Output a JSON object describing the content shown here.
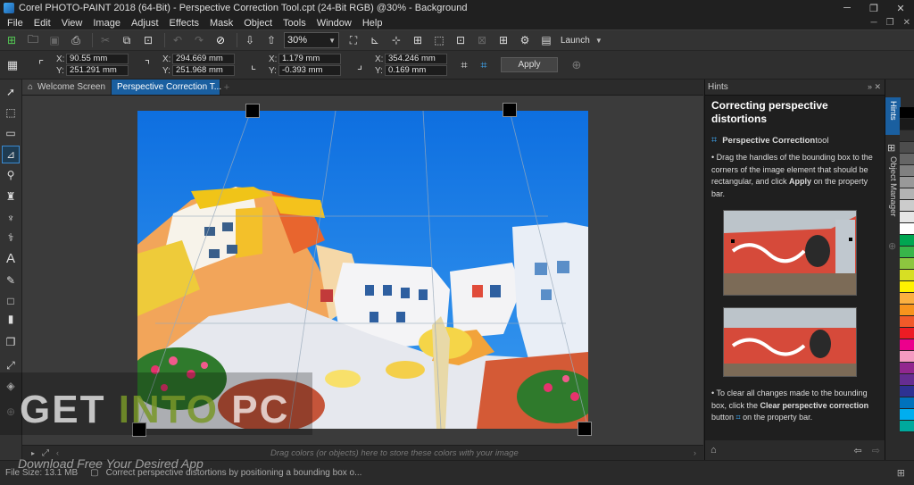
{
  "window": {
    "title": "Corel PHOTO-PAINT 2018 (64-Bit) - Perspective Correction Tool.cpt (24-Bit RGB) @30% - Background",
    "minimize": "─",
    "maximize": "❐",
    "close": "✕"
  },
  "menu": [
    "File",
    "Edit",
    "View",
    "Image",
    "Adjust",
    "Effects",
    "Mask",
    "Object",
    "Tools",
    "Window",
    "Help"
  ],
  "toolbar": {
    "zoom_value": "30%",
    "launch_label": "Launch"
  },
  "property_bar": {
    "group1": {
      "x": "90.55 mm",
      "y": "251.291 mm"
    },
    "group2": {
      "x": "294.669 mm",
      "y": "251.968 mm"
    },
    "group3": {
      "x": "1.179 mm",
      "y": "-0.393 mm"
    },
    "group4": {
      "x": "354.246 mm",
      "y": "0.169 mm"
    },
    "x_label": "X:",
    "y_label": "Y:",
    "apply_label": "Apply"
  },
  "doc_tabs": [
    {
      "label": "Welcome Screen"
    },
    {
      "label": "Perspective Correction T..."
    }
  ],
  "color_tray": {
    "hint": "Drag colors (or objects) here to store these colors with your image"
  },
  "status": {
    "file_size": "File Size: 13.1 MB",
    "message": "Correct perspective distortions by positioning a bounding box o..."
  },
  "hints": {
    "panel_title": "Hints",
    "title": "Correcting perspective distortions",
    "tool_name": "Perspective Correction",
    "tool_suffix": " tool",
    "step1": "Drag the handles of the bounding box to the corners of the image element that should be rectangular, and click ",
    "step1_bold": "Apply",
    "step1_end": " on the property bar.",
    "step2": "To clear all changes made to the bounding box, click the ",
    "step2_bold": "Clear perspective correction",
    "step2_mid": " button ",
    "step2_end": " on the property bar."
  },
  "docker_tabs": [
    "Hints",
    "Object Manager"
  ],
  "palette": [
    "#000000",
    "#1a1a1a",
    "#333333",
    "#4d4d4d",
    "#666666",
    "#808080",
    "#999999",
    "#b3b3b3",
    "#cccccc",
    "#e6e6e6",
    "#ffffff",
    "#00a651",
    "#39b54a",
    "#8dc63f",
    "#d7df23",
    "#fff200",
    "#fbb040",
    "#f7941d",
    "#f15a29",
    "#ed1c24",
    "#ec008c",
    "#f49ac1",
    "#92278f",
    "#662d91",
    "#2e3192",
    "#0072bc",
    "#00aeef",
    "#00a99d"
  ],
  "watermark": {
    "get": "GET ",
    "into": "INTO",
    "pc": " PC",
    "sub": "Download Free Your Desired App"
  }
}
